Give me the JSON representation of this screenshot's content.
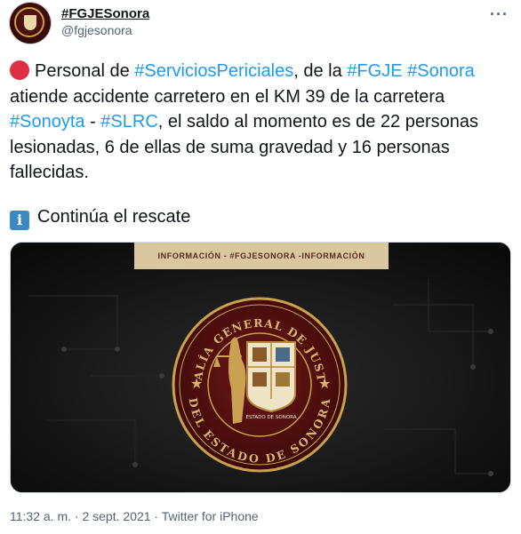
{
  "author": {
    "display_name": "#FGJESonora",
    "handle": "@fgjesonora"
  },
  "menu_icon": "ellipsis-icon",
  "tweet": {
    "segments": [
      {
        "text": "Personal de ",
        "tag": false
      },
      {
        "text": "#ServiciosPericiales",
        "tag": true
      },
      {
        "text": ", de la ",
        "tag": false
      },
      {
        "text": "#FGJE",
        "tag": true
      },
      {
        "text": " ",
        "tag": false
      },
      {
        "text": "#Sonora",
        "tag": true
      },
      {
        "text": " atiende accidente carretero en el KM 39 de la carretera ",
        "tag": false
      },
      {
        "text": "#Sonoyta",
        "tag": true
      },
      {
        "text": " - ",
        "tag": false
      },
      {
        "text": "#SLRC",
        "tag": true
      },
      {
        "text": ", el saldo al momento es de 22 personas lesionadas, 6 de ellas de suma gravedad y 16 personas fallecidas.",
        "tag": false
      }
    ],
    "line2": "Continúa el rescate",
    "emoji_1": "red-circle-icon",
    "emoji_2": "info-icon"
  },
  "media": {
    "banner": "INFORMACIÓN - #FGJESONORA -INFORMACIÓN",
    "seal_top": "FISCALÍA GENERAL DE JUSTICIA",
    "seal_bottom": "DEL ESTADO DE SONORA",
    "seal_inner": "ESTADO DE SONORA"
  },
  "footer": {
    "time": "11:32 a. m.",
    "sep": " · ",
    "date": "2 sept. 2021",
    "source": "Twitter for iPhone"
  },
  "colors": {
    "link": "#1d9bf0",
    "seal_maroon": "#5e1414",
    "seal_gold": "#c9a24a"
  }
}
